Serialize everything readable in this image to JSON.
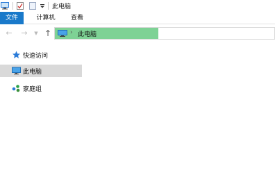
{
  "window": {
    "title": "此电脑"
  },
  "ribbon": {
    "tabs": [
      {
        "label": "文件",
        "active": true
      },
      {
        "label": "计算机",
        "active": false
      },
      {
        "label": "查看",
        "active": false
      }
    ]
  },
  "address_bar": {
    "path": "此电脑",
    "load_progress": 0.47
  },
  "sidebar": {
    "items": [
      {
        "label": "快速访问",
        "icon": "star-icon"
      },
      {
        "label": "此电脑",
        "icon": "computer-icon",
        "selected": true
      },
      {
        "label": "家庭组",
        "icon": "homegroup-icon"
      }
    ]
  },
  "colors": {
    "file_tab": "#1979ca",
    "selected_item": "#d9d9d9",
    "progress": "#7ed295",
    "star": "#2b7bd8",
    "homegroup": "#2aa34a"
  }
}
